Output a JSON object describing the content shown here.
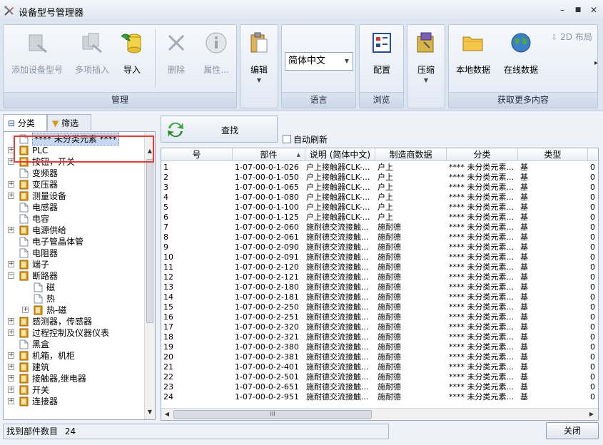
{
  "window": {
    "title": "设备型号管理器",
    "minimize_glyph": "–",
    "maximize_glyph": "■",
    "close_glyph": "✕"
  },
  "ribbon": {
    "groups": [
      {
        "label": "管理",
        "buttons": [
          {
            "label": "添加设备型号",
            "icon": "add-device-icon",
            "enabled": false
          },
          {
            "label": "多项插入",
            "icon": "multi-insert-icon",
            "enabled": false
          },
          {
            "label": "导入",
            "icon": "import-icon",
            "enabled": true
          },
          {
            "label": "删除",
            "icon": "delete-icon",
            "enabled": false
          },
          {
            "label": "属性...",
            "icon": "info-icon",
            "enabled": false
          }
        ]
      },
      {
        "label": "",
        "buttons": [
          {
            "label": "编辑",
            "icon": "clipboard-icon",
            "enabled": true
          }
        ]
      },
      {
        "label": "语言",
        "select_value": "简体中文"
      },
      {
        "label": "浏览",
        "buttons": [
          {
            "label": "配置",
            "icon": "configure-icon",
            "enabled": true
          }
        ]
      },
      {
        "label": "",
        "buttons": [
          {
            "label": "压缩",
            "icon": "compress-icon",
            "enabled": true
          }
        ]
      },
      {
        "label": "获取更多内容",
        "buttons": [
          {
            "label": "本地数据",
            "icon": "folder-icon",
            "enabled": true
          },
          {
            "label": "在线数据",
            "icon": "globe-icon",
            "enabled": true
          },
          {
            "label": "2D 布局",
            "icon": "download-icon",
            "enabled": false
          }
        ]
      }
    ],
    "scroll_glyph": "▸"
  },
  "left": {
    "tabs": [
      {
        "label": "分类",
        "icon": "tree-icon"
      },
      {
        "label": "筛选",
        "icon": "filter-icon"
      }
    ],
    "tree": [
      {
        "label": "**** 未分类元素 ****",
        "expand": false,
        "icon": "doc",
        "level": 0,
        "selected": true
      },
      {
        "label": "PLC",
        "expand": true,
        "icon": "book",
        "level": 0
      },
      {
        "label": "按钮，开关",
        "expand": true,
        "icon": "book",
        "level": 0
      },
      {
        "label": "变频器",
        "expand": false,
        "icon": "doc",
        "level": 0
      },
      {
        "label": "变压器",
        "expand": true,
        "icon": "book",
        "level": 0
      },
      {
        "label": "测量设备",
        "expand": true,
        "icon": "book",
        "level": 0
      },
      {
        "label": "电感器",
        "expand": false,
        "icon": "doc",
        "level": 0
      },
      {
        "label": "电容",
        "expand": false,
        "icon": "doc",
        "level": 0
      },
      {
        "label": "电源供给",
        "expand": true,
        "icon": "book",
        "level": 0
      },
      {
        "label": "电子管晶体管",
        "expand": false,
        "icon": "doc",
        "level": 0
      },
      {
        "label": "电阻器",
        "expand": false,
        "icon": "doc",
        "level": 0
      },
      {
        "label": "端子",
        "expand": true,
        "icon": "book",
        "level": 0
      },
      {
        "label": "断路器",
        "expand": true,
        "icon": "book",
        "level": 0,
        "open": true
      },
      {
        "label": "磁",
        "expand": false,
        "icon": "doc",
        "level": 1
      },
      {
        "label": "热",
        "expand": false,
        "icon": "doc",
        "level": 1
      },
      {
        "label": "热-磁",
        "expand": true,
        "icon": "book",
        "level": 1
      },
      {
        "label": "感测器，传感器",
        "expand": true,
        "icon": "book",
        "level": 0
      },
      {
        "label": "过程控制及仪器仪表",
        "expand": true,
        "icon": "book",
        "level": 0
      },
      {
        "label": "黑盒",
        "expand": false,
        "icon": "doc",
        "level": 0
      },
      {
        "label": "机箱，机柜",
        "expand": true,
        "icon": "book",
        "level": 0
      },
      {
        "label": "建筑",
        "expand": true,
        "icon": "book",
        "level": 0
      },
      {
        "label": "接触器,继电器",
        "expand": true,
        "icon": "book",
        "level": 0
      },
      {
        "label": "开关",
        "expand": true,
        "icon": "book",
        "level": 0
      },
      {
        "label": "连接器",
        "expand": true,
        "icon": "book",
        "level": 0
      }
    ]
  },
  "search": {
    "label": "查找",
    "auto_refresh_label": "自动刷新"
  },
  "grid": {
    "columns": [
      "号",
      "部件",
      "说明 (简体中文)",
      "制造商数据",
      "分类",
      "类型"
    ],
    "sort_glyph": "▲",
    "rows": [
      [
        "1",
        "1-07-00-0-1-026",
        "户上接触器CLK-...",
        "户上",
        "**** 未分类元素...",
        "基",
        "0"
      ],
      [
        "2",
        "1-07-00-0-1-050",
        "户上接触器CLK-...",
        "户上",
        "**** 未分类元素...",
        "基",
        "0"
      ],
      [
        "3",
        "1-07-00-0-1-065",
        "户上接触器CLK-...",
        "户上",
        "**** 未分类元素...",
        "基",
        "0"
      ],
      [
        "4",
        "1-07-00-0-1-080",
        "户上接触器CLK-...",
        "户上",
        "**** 未分类元素...",
        "基",
        "0"
      ],
      [
        "5",
        "1-07-00-0-1-100",
        "户上接触器CLK-...",
        "户上",
        "**** 未分类元素...",
        "基",
        "0"
      ],
      [
        "6",
        "1-07-00-0-1-125",
        "户上接触器CLK-...",
        "户上",
        "**** 未分类元素...",
        "基",
        "0"
      ],
      [
        "7",
        "1-07-00-0-2-060",
        "施耐德交流接触...",
        "施耐德",
        "**** 未分类元素...",
        "基",
        "0"
      ],
      [
        "8",
        "1-07-00-0-2-061",
        "施耐德交流接触...",
        "施耐德",
        "**** 未分类元素...",
        "基",
        "0"
      ],
      [
        "9",
        "1-07-00-0-2-090",
        "施耐德交流接触...",
        "施耐德",
        "**** 未分类元素...",
        "基",
        "0"
      ],
      [
        "10",
        "1-07-00-0-2-091",
        "施耐德交流接触...",
        "施耐德",
        "**** 未分类元素...",
        "基",
        "0"
      ],
      [
        "11",
        "1-07-00-0-2-120",
        "施耐德交流接触...",
        "施耐德",
        "**** 未分类元素...",
        "基",
        "0"
      ],
      [
        "12",
        "1-07-00-0-2-121",
        "施耐德交流接触...",
        "施耐德",
        "**** 未分类元素...",
        "基",
        "0"
      ],
      [
        "13",
        "1-07-00-0-2-180",
        "施耐德交流接触...",
        "施耐德",
        "**** 未分类元素...",
        "基",
        "0"
      ],
      [
        "14",
        "1-07-00-0-2-181",
        "施耐德交流接触...",
        "施耐德",
        "**** 未分类元素...",
        "基",
        "0"
      ],
      [
        "15",
        "1-07-00-0-2-250",
        "施耐德交流接触...",
        "施耐德",
        "**** 未分类元素...",
        "基",
        "0"
      ],
      [
        "16",
        "1-07-00-0-2-251",
        "施耐德交流接触...",
        "施耐德",
        "**** 未分类元素...",
        "基",
        "0"
      ],
      [
        "17",
        "1-07-00-0-2-320",
        "施耐德交流接触...",
        "施耐德",
        "**** 未分类元素...",
        "基",
        "0"
      ],
      [
        "18",
        "1-07-00-0-2-321",
        "施耐德交流接触...",
        "施耐德",
        "**** 未分类元素...",
        "基",
        "0"
      ],
      [
        "19",
        "1-07-00-0-2-380",
        "施耐德交流接触...",
        "施耐德",
        "**** 未分类元素...",
        "基",
        "0"
      ],
      [
        "20",
        "1-07-00-0-2-381",
        "施耐德交流接触...",
        "施耐德",
        "**** 未分类元素...",
        "基",
        "0"
      ],
      [
        "21",
        "1-07-00-0-2-401",
        "施耐德交流接触...",
        "施耐德",
        "**** 未分类元素...",
        "基",
        "0"
      ],
      [
        "22",
        "1-07-00-0-2-501",
        "施耐德交流接触...",
        "施耐德",
        "**** 未分类元素...",
        "基",
        "0"
      ],
      [
        "23",
        "1-07-00-0-2-651",
        "施耐德交流接触...",
        "施耐德",
        "**** 未分类元素...",
        "基",
        "0"
      ],
      [
        "24",
        "1-07-00-0-2-951",
        "施耐德交流接触...",
        "施耐德",
        "**** 未分类元素...",
        "基",
        "0"
      ]
    ],
    "hscroll_grip": "III"
  },
  "status": {
    "label": "找到部件数目",
    "count": "24"
  },
  "close_button": "关闭",
  "colors": {
    "highlight": "#e23c3c",
    "selection": "#c7d9f3",
    "book": "#e8a21c"
  }
}
